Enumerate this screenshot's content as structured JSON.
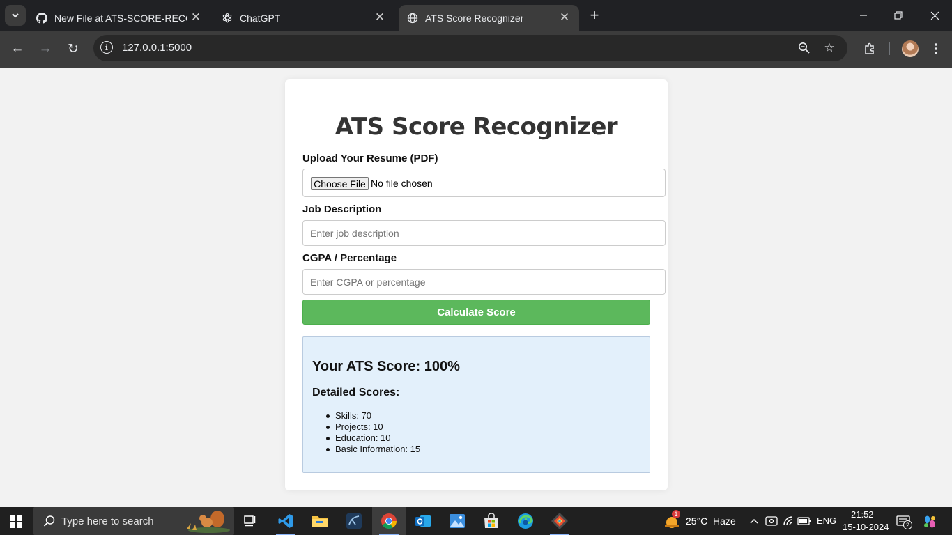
{
  "browser": {
    "tabs": [
      {
        "title": "New File at ATS-SCORE-RECOGI",
        "favicon": "github-icon"
      },
      {
        "title": "ChatGPT",
        "favicon": "chatgpt-icon"
      },
      {
        "title": "ATS Score Recognizer",
        "favicon": "globe-icon"
      }
    ],
    "url": "127.0.0.1:5000"
  },
  "page": {
    "title": "ATS Score Recognizer",
    "upload_label": "Upload Your Resume (PDF)",
    "choose_file_label": "Choose File",
    "file_status": "No file chosen",
    "job_label": "Job Description",
    "job_placeholder": "Enter job description",
    "cgpa_label": "CGPA / Percentage",
    "cgpa_placeholder": "Enter CGPA or percentage",
    "calculate_label": "Calculate Score",
    "result": {
      "score_heading": "Your ATS Score: 100%",
      "detail_heading": "Detailed Scores:",
      "items": [
        "Skills: 70",
        "Projects: 10",
        "Education: 10",
        "Basic Information: 15"
      ]
    }
  },
  "taskbar": {
    "search_placeholder": "Type here to search",
    "weather": "25°C  Haze",
    "weather_badge": "1",
    "language": "ENG",
    "time": "21:52",
    "date": "15-10-2024",
    "notification_count": "2"
  },
  "colors": {
    "accent_button": "#5cb85c",
    "result_background": "#e3f0fb",
    "browser_frame": "#202124"
  }
}
